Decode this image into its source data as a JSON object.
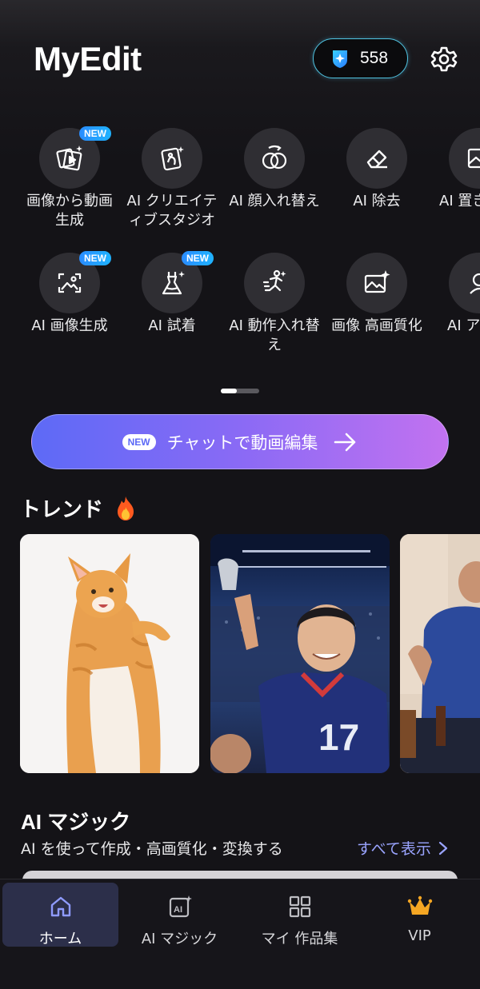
{
  "header": {
    "app_title": "MyEdit",
    "credits": "558"
  },
  "tools": [
    {
      "label": "画像から動画生成",
      "icon": "image-to-video-icon",
      "new": true
    },
    {
      "label": "AI クリエイティブスタジオ",
      "icon": "creative-studio-icon",
      "new": false
    },
    {
      "label": "AI 顔入れ替え",
      "icon": "face-swap-icon",
      "new": false
    },
    {
      "label": "AI 除去",
      "icon": "eraser-icon",
      "new": false
    },
    {
      "label": "AI 置き",
      "icon": "replace-icon",
      "new": false
    },
    {
      "label": "AI 画像生成",
      "icon": "image-generate-icon",
      "new": true
    },
    {
      "label": "AI 試着",
      "icon": "dress-icon",
      "new": true
    },
    {
      "label": "AI 動作入れ替え",
      "icon": "motion-swap-icon",
      "new": false
    },
    {
      "label": "画像 高画質化",
      "icon": "image-enhance-icon",
      "new": false
    },
    {
      "label": "AI ア",
      "icon": "avatar-icon",
      "new": false
    }
  ],
  "new_badge": "NEW",
  "chat_button": {
    "badge": "NEW",
    "label": "チャットで動画編集"
  },
  "trend": {
    "title": "トレンド"
  },
  "ai_magic": {
    "title": "AI マジック",
    "subtitle": "AI を使って作成・高画質化・変換する",
    "see_all": "すべて表示"
  },
  "bottom_nav": [
    {
      "label": "ホーム",
      "icon": "home-icon",
      "active": true
    },
    {
      "label": "AI マジック",
      "icon": "ai-magic-icon",
      "active": false
    },
    {
      "label": "マイ 作品集",
      "icon": "grid-icon",
      "active": false
    },
    {
      "label": "VIP",
      "icon": "crown-icon",
      "active": false
    }
  ],
  "colors": {
    "background": "#141317",
    "accent": "#9aa4ff",
    "credit_border": "#4fc3e0",
    "new_badge": "#2a8cff",
    "crown": "#f5a623"
  }
}
